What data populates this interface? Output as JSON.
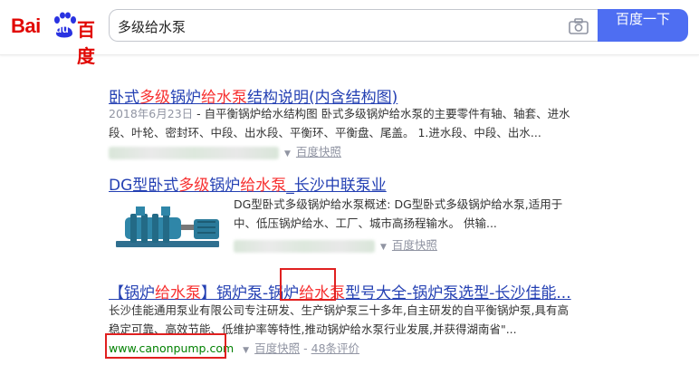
{
  "header": {
    "logo": {
      "part1": "Bai",
      "part2": "du",
      "part3": "百度"
    },
    "query": "多级给水泵",
    "search_button": "百度一下"
  },
  "results": [
    {
      "title_parts": [
        "卧式",
        "多级",
        "锅炉",
        "给水泵",
        "结构说明(内含结构图)"
      ],
      "date": "2018年6月23日",
      "abstract_line1": " - 自平衡锅炉给水结构图 卧式多级锅炉给水泵的主要零件有轴、轴套、进水",
      "abstract_line2": "段、叶轮、密封环、中段、出水段、平衡环、平衡盘、尾盖。 1.进水段、中段、出水...",
      "snapshot": "百度快照"
    },
    {
      "title_parts": [
        "DG型卧式",
        "多级",
        "锅炉",
        "给水泵",
        "_长沙中联泵业"
      ],
      "abstract_line1": "DG型卧式多级锅炉给水泵概述: DG型卧式多级锅炉给水泵,适用于",
      "abstract_line2": "中、低压锅炉给水、工厂、城市高扬程输水。 供输...",
      "snapshot": "百度快照"
    },
    {
      "title_parts": [
        "【锅炉",
        "给水泵",
        "】锅炉泵-锅炉",
        "给水泵",
        "型号大全-锅炉泵选型-长沙佳能..."
      ],
      "abstract_line1": "长沙佳能通用泵业有限公司专注研发、生产锅炉泵三十多年,自主研发的自平衡锅炉泵,具有高",
      "abstract_line2": "稳定可靠、高效节能、低维护率等特性,推动锅炉给水泵行业发展,并获得湖南省\"...",
      "url": "www.canonpump.com",
      "snapshot": "百度快照",
      "reviews": "48条评价"
    }
  ],
  "colors": {
    "accent": "#4e6ef2",
    "title_link": "#2440b3",
    "highlight": "#f73131",
    "annotation": "#e02020"
  }
}
